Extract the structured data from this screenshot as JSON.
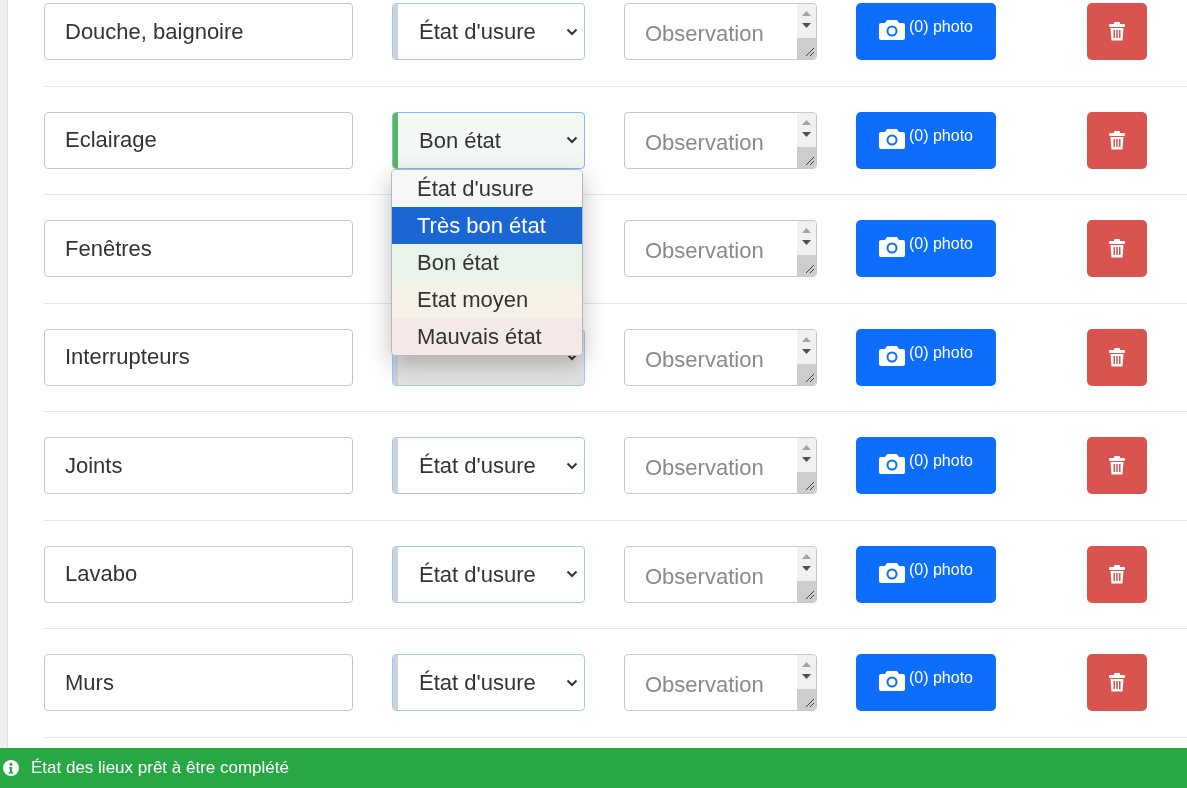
{
  "rows": [
    {
      "name": "Douche, baignoire",
      "condition": {
        "label": "État d'usure",
        "color": "#c9d3df"
      },
      "observation_placeholder": "Observation",
      "photo_button": "(0) photo",
      "menu_open": false
    },
    {
      "name": "Eclairage",
      "condition": {
        "label": "Bon état",
        "color": "#5cb85c"
      },
      "observation_placeholder": "Observation",
      "photo_button": "(0) photo",
      "menu_open": true
    },
    {
      "name": "Fenêtres",
      "observation_placeholder": "Observation",
      "photo_button": "(0) photo",
      "menu_open": false
    },
    {
      "name": "Interrupteurs",
      "condition": {
        "color": "#c9d3df"
      },
      "observation_placeholder": "Observation",
      "photo_button": "(0) photo",
      "menu_open": false
    },
    {
      "name": "Joints",
      "condition": {
        "label": "État d'usure",
        "color": "#c9d3df"
      },
      "observation_placeholder": "Observation",
      "photo_button": "(0) photo",
      "menu_open": false
    },
    {
      "name": "Lavabo",
      "condition": {
        "label": "État d'usure",
        "color": "#c9d3df"
      },
      "observation_placeholder": "Observation",
      "photo_button": "(0) photo",
      "menu_open": false
    },
    {
      "name": "Murs",
      "condition": {
        "label": "État d'usure",
        "color": "#c9d3df"
      },
      "observation_placeholder": "Observation",
      "photo_button": "(0) photo",
      "menu_open": false
    }
  ],
  "dropdown": {
    "options": [
      {
        "label": "État d'usure",
        "color": "#f5f8f6",
        "selected": false
      },
      {
        "label": "Très bon état",
        "color": "#1a66d2",
        "selected": true
      },
      {
        "label": "Bon état",
        "color": "#e8f3e9",
        "selected": false
      },
      {
        "label": "Etat moyen",
        "color": "#f6f2e8",
        "selected": false
      },
      {
        "label": "Mauvais état",
        "color": "#f4e8e8",
        "selected": false
      }
    ]
  },
  "status_bar": {
    "message": "État des lieux prêt à être complété"
  }
}
